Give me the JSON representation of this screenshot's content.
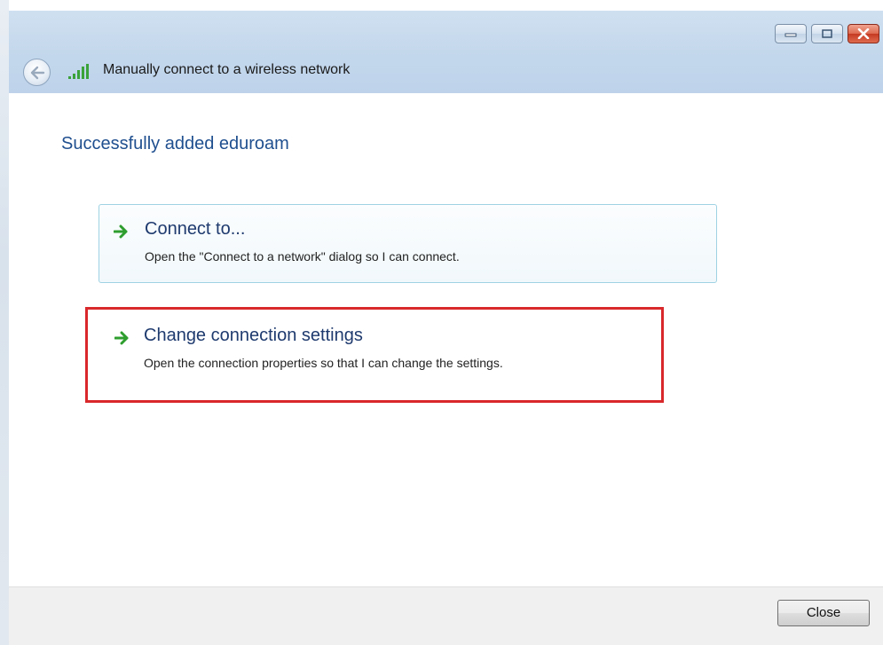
{
  "window": {
    "title": "Manually connect to a wireless network",
    "caption_buttons": [
      "minimize",
      "maximize",
      "close"
    ]
  },
  "main": {
    "heading": "Successfully added eduroam",
    "options": [
      {
        "title": "Connect to...",
        "description": "Open the \"Connect to a network\" dialog so I can connect."
      },
      {
        "title": "Change connection settings",
        "description": "Open the connection properties so that I can change the settings."
      }
    ]
  },
  "footer": {
    "close_label": "Close"
  },
  "icons": {
    "back": "back-arrow-icon",
    "network": "wireless-signal-icon",
    "option_arrow": "green-arrow-icon"
  },
  "colors": {
    "accent_blue": "#1f4f8f",
    "highlight_red": "#d9282b",
    "arrow_green": "#2e9e2e"
  }
}
